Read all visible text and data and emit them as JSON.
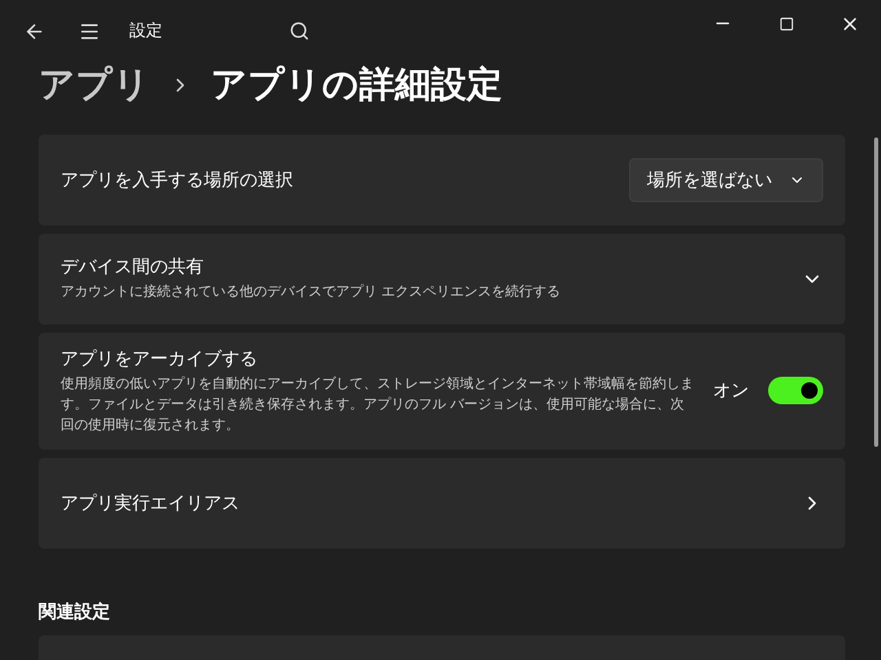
{
  "window": {
    "title": "設定"
  },
  "breadcrumb": [
    {
      "label": "アプリ",
      "current": false
    },
    {
      "label": "アプリの詳細設定",
      "current": true
    }
  ],
  "settings": [
    {
      "kind": "dropdown",
      "title": "アプリを入手する場所の選択",
      "value": "場所を選ばない"
    },
    {
      "kind": "expander",
      "title": "デバイス間の共有",
      "description": "アカウントに接続されている他のデバイスでアプリ エクスペリエンスを続行する",
      "expanded": false
    },
    {
      "kind": "toggle",
      "title": "アプリをアーカイブする",
      "description": "使用頻度の低いアプリを自動的にアーカイブして、ストレージ領域とインターネット帯域幅を節約します。ファイルとデータは引き続き保存されます。アプリのフル バージョンは、使用可能な場合に、次回の使用時に復元されます。",
      "on": true,
      "state_label": "オン"
    },
    {
      "kind": "link",
      "title": "アプリ実行エイリアス"
    }
  ],
  "related": {
    "heading": "関連設定"
  }
}
